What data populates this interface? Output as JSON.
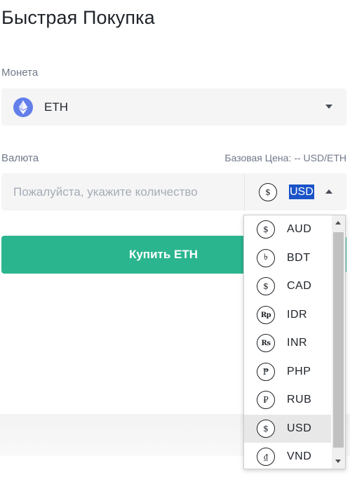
{
  "page": {
    "title": "Быстрая Покупка"
  },
  "coin": {
    "label": "Монета",
    "selected": "ETH",
    "icon": "ethereum-icon",
    "icon_color": "#627eea"
  },
  "currency": {
    "label": "Валюта",
    "base_price_label": "Базовая Цена:",
    "base_price_value": "-- USD/ETH",
    "amount_placeholder": "Пожалуйста, укажите количество",
    "selected": "USD",
    "selected_symbol": "$"
  },
  "buy_button": {
    "label": "Купить ETH",
    "color": "#2bb58f"
  },
  "currency_options": [
    {
      "code": "AUD",
      "symbol": "$"
    },
    {
      "code": "BDT",
      "symbol": "৳"
    },
    {
      "code": "CAD",
      "symbol": "$"
    },
    {
      "code": "IDR",
      "symbol": "Rp"
    },
    {
      "code": "INR",
      "symbol": "Rs"
    },
    {
      "code": "PHP",
      "symbol": "₱"
    },
    {
      "code": "RUB",
      "symbol": "₽"
    },
    {
      "code": "USD",
      "symbol": "$"
    },
    {
      "code": "VND",
      "symbol": "₫"
    }
  ]
}
